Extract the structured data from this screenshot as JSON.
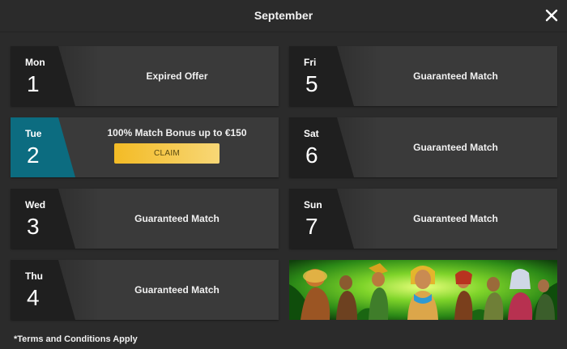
{
  "header": {
    "title": "September"
  },
  "days": [
    {
      "day": "Mon",
      "num": "1",
      "label": "Expired Offer"
    },
    {
      "day": "Tue",
      "num": "2",
      "label": "100% Match Bonus up to €150",
      "button": "CLAIM"
    },
    {
      "day": "Wed",
      "num": "3",
      "label": "Guaranteed Match"
    },
    {
      "day": "Thu",
      "num": "4",
      "label": "Guaranteed Match"
    },
    {
      "day": "Fri",
      "num": "5",
      "label": "Guaranteed Match"
    },
    {
      "day": "Sat",
      "num": "6",
      "label": "Guaranteed Match"
    },
    {
      "day": "Sun",
      "num": "7",
      "label": "Guaranteed Match"
    }
  ],
  "footer": {
    "terms": "*Terms and Conditions Apply"
  },
  "icons": {
    "close": "close-icon"
  },
  "colors": {
    "background": "#2b2b2b",
    "card": "#3a3a3a",
    "active": "#0c6c80",
    "claim": "#f3bb25"
  }
}
